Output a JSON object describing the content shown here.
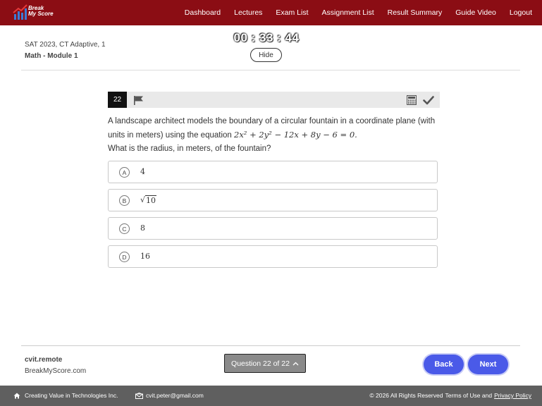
{
  "brand": {
    "logo_text_line1": "Break",
    "logo_text_line2": "My Score"
  },
  "nav": {
    "items": [
      "Dashboard",
      "Lectures",
      "Exam List",
      "Assignment List",
      "Result Summary",
      "Guide Video",
      "Logout"
    ]
  },
  "header": {
    "exam_name": "SAT 2023, CT Adaptive, 1",
    "module_name": "Math - Module 1",
    "timer": "00 : 33 : 44",
    "hide_label": "Hide"
  },
  "question": {
    "number": "22",
    "text_before": "A landscape architect models the boundary of a circular fountain in a coordinate plane (with units in meters) using the equation ",
    "equation": "2x² + 2y² − 12x + 8y − 6 = 0.",
    "text_after": "What is the radius, in meters, of the fountain?",
    "choices": [
      {
        "letter": "A",
        "value": "4"
      },
      {
        "letter": "B",
        "value": "10",
        "sqrt": true
      },
      {
        "letter": "C",
        "value": "8"
      },
      {
        "letter": "D",
        "value": "16"
      }
    ]
  },
  "footer": {
    "user_name": "cvit.remote",
    "site_name": "BreakMyScore.com",
    "question_nav_label": "Question 22 of 22",
    "back_label": "Back",
    "next_label": "Next"
  },
  "bottombar": {
    "company": "Creating Value in Technologies Inc.",
    "email": "cvit.peter@gmail.com",
    "copyright": "© 2026 All Rights Reserved",
    "terms": "Terms of Use and",
    "privacy": "Privacy Policy"
  },
  "colors": {
    "nav_bg": "#8b0d14",
    "primary_button": "#4a5ae8",
    "bottom_bar": "#5f5f5f"
  },
  "icons": [
    "home-icon",
    "email-icon",
    "flag-icon",
    "calculator-icon",
    "check-icon",
    "chevron-up-icon"
  ]
}
